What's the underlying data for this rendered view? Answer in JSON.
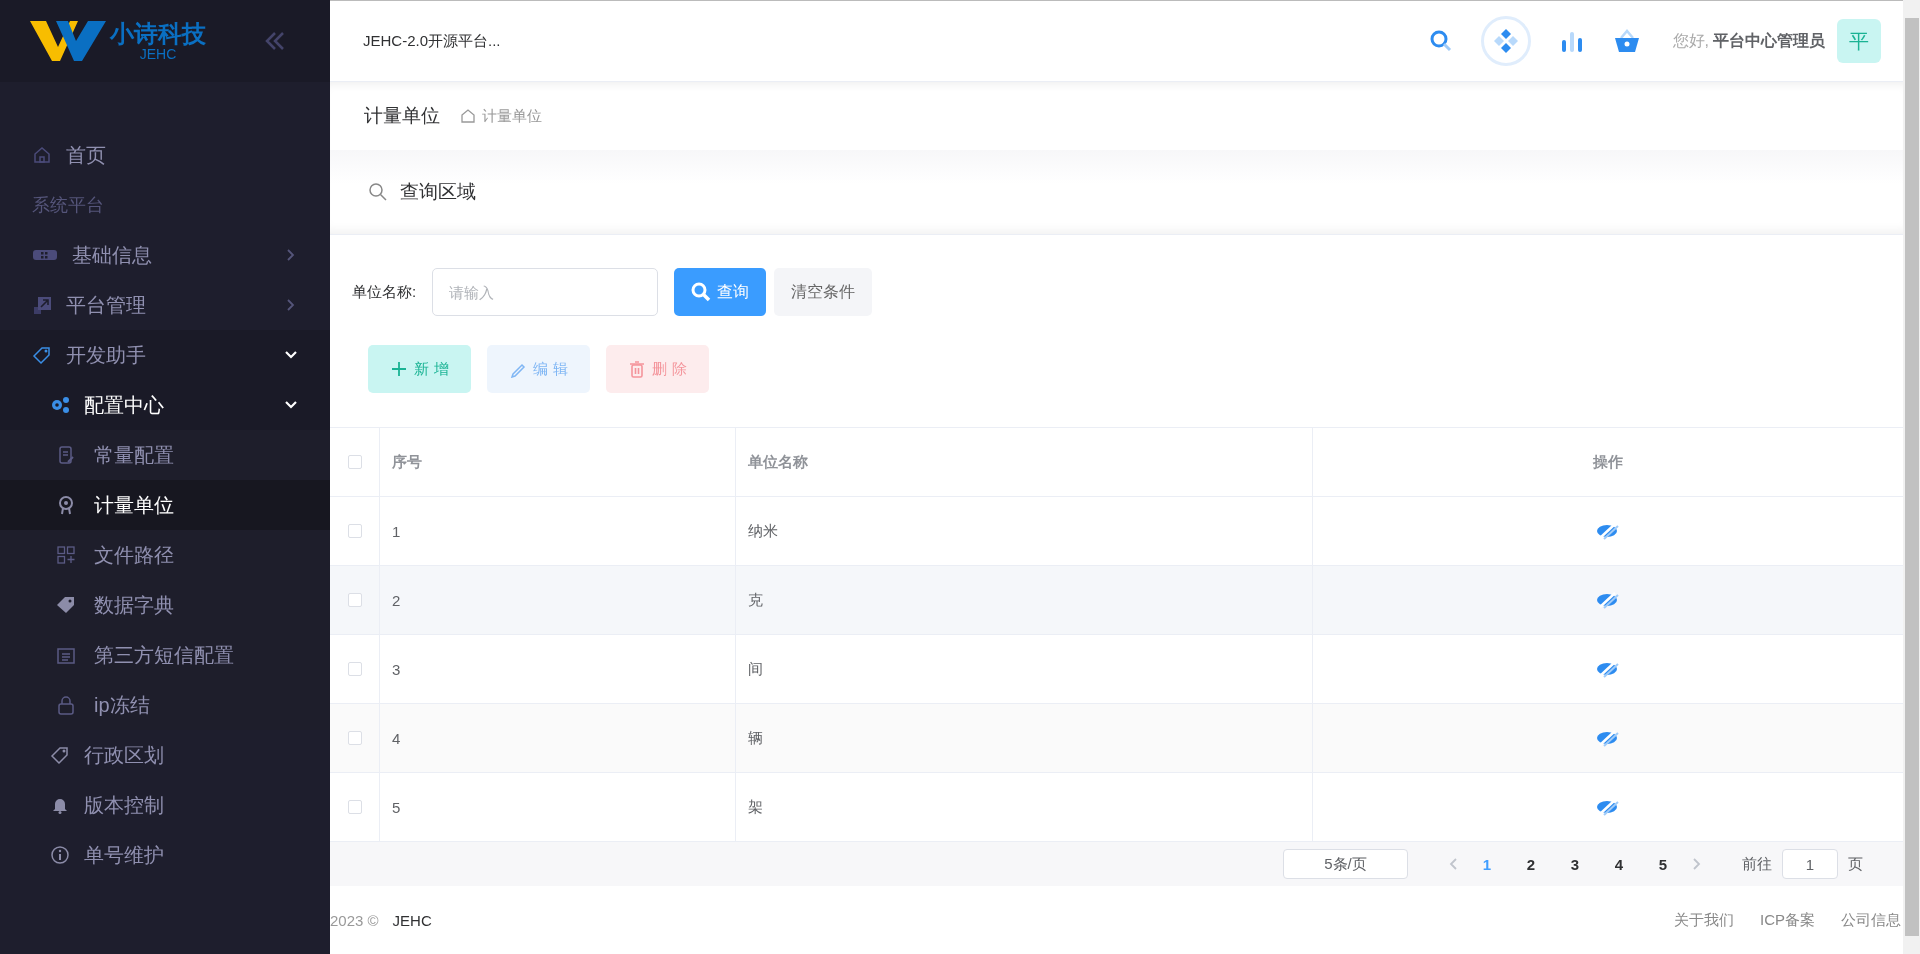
{
  "sidebar": {
    "logo_title": "小诗科技",
    "logo_subtitle": "JEHC",
    "items": [
      {
        "kind": "link",
        "label": "首页",
        "selected": false
      },
      {
        "kind": "section",
        "label": "系统平台"
      },
      {
        "kind": "group",
        "label": "基础信息",
        "expanded": false
      },
      {
        "kind": "group",
        "label": "平台管理",
        "expanded": false
      },
      {
        "kind": "group",
        "label": "开发助手",
        "expanded": true,
        "children": [
          {
            "kind": "group",
            "label": "配置中心",
            "expanded": true,
            "children": [
              {
                "kind": "link",
                "label": "常量配置",
                "selected": false
              },
              {
                "kind": "link",
                "label": "计量单位",
                "selected": true
              },
              {
                "kind": "link",
                "label": "文件路径",
                "selected": false
              },
              {
                "kind": "link",
                "label": "数据字典",
                "selected": false
              },
              {
                "kind": "link",
                "label": "第三方短信配置",
                "selected": false
              },
              {
                "kind": "link",
                "label": "ip冻结",
                "selected": false
              }
            ]
          },
          {
            "kind": "link",
            "label": "行政区划",
            "selected": false
          },
          {
            "kind": "link",
            "label": "版本控制",
            "selected": false
          },
          {
            "kind": "link",
            "label": "单号维护",
            "selected": false
          }
        ]
      }
    ]
  },
  "header": {
    "title": "JEHC-2.0开源平台...",
    "greeting": "您好,",
    "user_name": "平台中心管理员",
    "avatar": "平"
  },
  "breadcrumb": {
    "page_title": "计量单位",
    "crumb": "计量单位"
  },
  "query": {
    "title": "查询区域",
    "field_label": "单位名称:",
    "placeholder": "请输入",
    "buttons": [
      {
        "kind": "primary",
        "label": "查询"
      },
      {
        "kind": "plain",
        "label": "清空条件"
      }
    ]
  },
  "toolbar": [
    {
      "kind": "add",
      "label": "新增",
      "disabled": false
    },
    {
      "kind": "edit",
      "label": "编辑",
      "disabled": true
    },
    {
      "kind": "delete",
      "label": "删除",
      "disabled": true
    }
  ],
  "table": {
    "select_all_checked": false,
    "columns": [
      "序号",
      "单位名称",
      "操作"
    ],
    "rows": [
      {
        "checked": false,
        "index": "1",
        "name": "纳米"
      },
      {
        "checked": false,
        "index": "2",
        "name": "克"
      },
      {
        "checked": false,
        "index": "3",
        "name": "间"
      },
      {
        "checked": false,
        "index": "4",
        "name": "辆"
      },
      {
        "checked": false,
        "index": "5",
        "name": "架"
      }
    ]
  },
  "pagination": {
    "page_size": "5条/页",
    "pages": [
      {
        "label": "1",
        "selected": true
      },
      {
        "label": "2",
        "selected": false
      },
      {
        "label": "3",
        "selected": false
      },
      {
        "label": "4",
        "selected": false
      },
      {
        "label": "5",
        "selected": false
      }
    ],
    "goto_label": "前往",
    "goto_value": "1",
    "goto_suffix": "页"
  },
  "footer": {
    "year": "2023 ©",
    "brand": "JEHC",
    "links": [
      "关于我们",
      "ICP备案",
      "公司信息"
    ]
  }
}
